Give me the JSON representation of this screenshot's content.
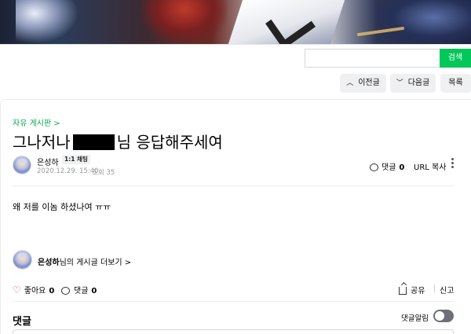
{
  "search": {
    "button_label": "검색",
    "placeholder": "",
    "value": ""
  },
  "nav": {
    "prev_label": "이전글",
    "next_label": "다음글",
    "list_label": "목록"
  },
  "article": {
    "board_name": "자유 게시판",
    "board_chevron": ">",
    "title_before": "그나저나",
    "title_after": "님 응답해주세여",
    "author": "은성하",
    "chat_badge": "1:1 채팅",
    "date": "2020.12.29. 15:40",
    "views": "조회 35",
    "comments_label": "댓글",
    "comments_count": "0",
    "url_copy": "URL 복사",
    "body": "왜 저를 이놈 하셨나여 ㅠㅠ"
  },
  "more_posts": {
    "author": "은성하",
    "suffix": "님의 게시글 더보기 >"
  },
  "actions": {
    "like_label": "좋아요",
    "like_count": "0",
    "comment_label": "댓글",
    "comment_count": "0",
    "share_label": "공유",
    "report_label": "신고"
  },
  "comments_section": {
    "title": "댓글",
    "notify_label": "댓글알림",
    "notify_on": false
  },
  "colors": {
    "accent": "#03c75a",
    "board_link": "#03a94d",
    "heart": "#e0303a"
  },
  "icons": [
    "chevron-up-icon",
    "chevron-down-icon",
    "comment-bubble-icon",
    "more-vertical-icon",
    "heart-icon",
    "share-icon"
  ]
}
